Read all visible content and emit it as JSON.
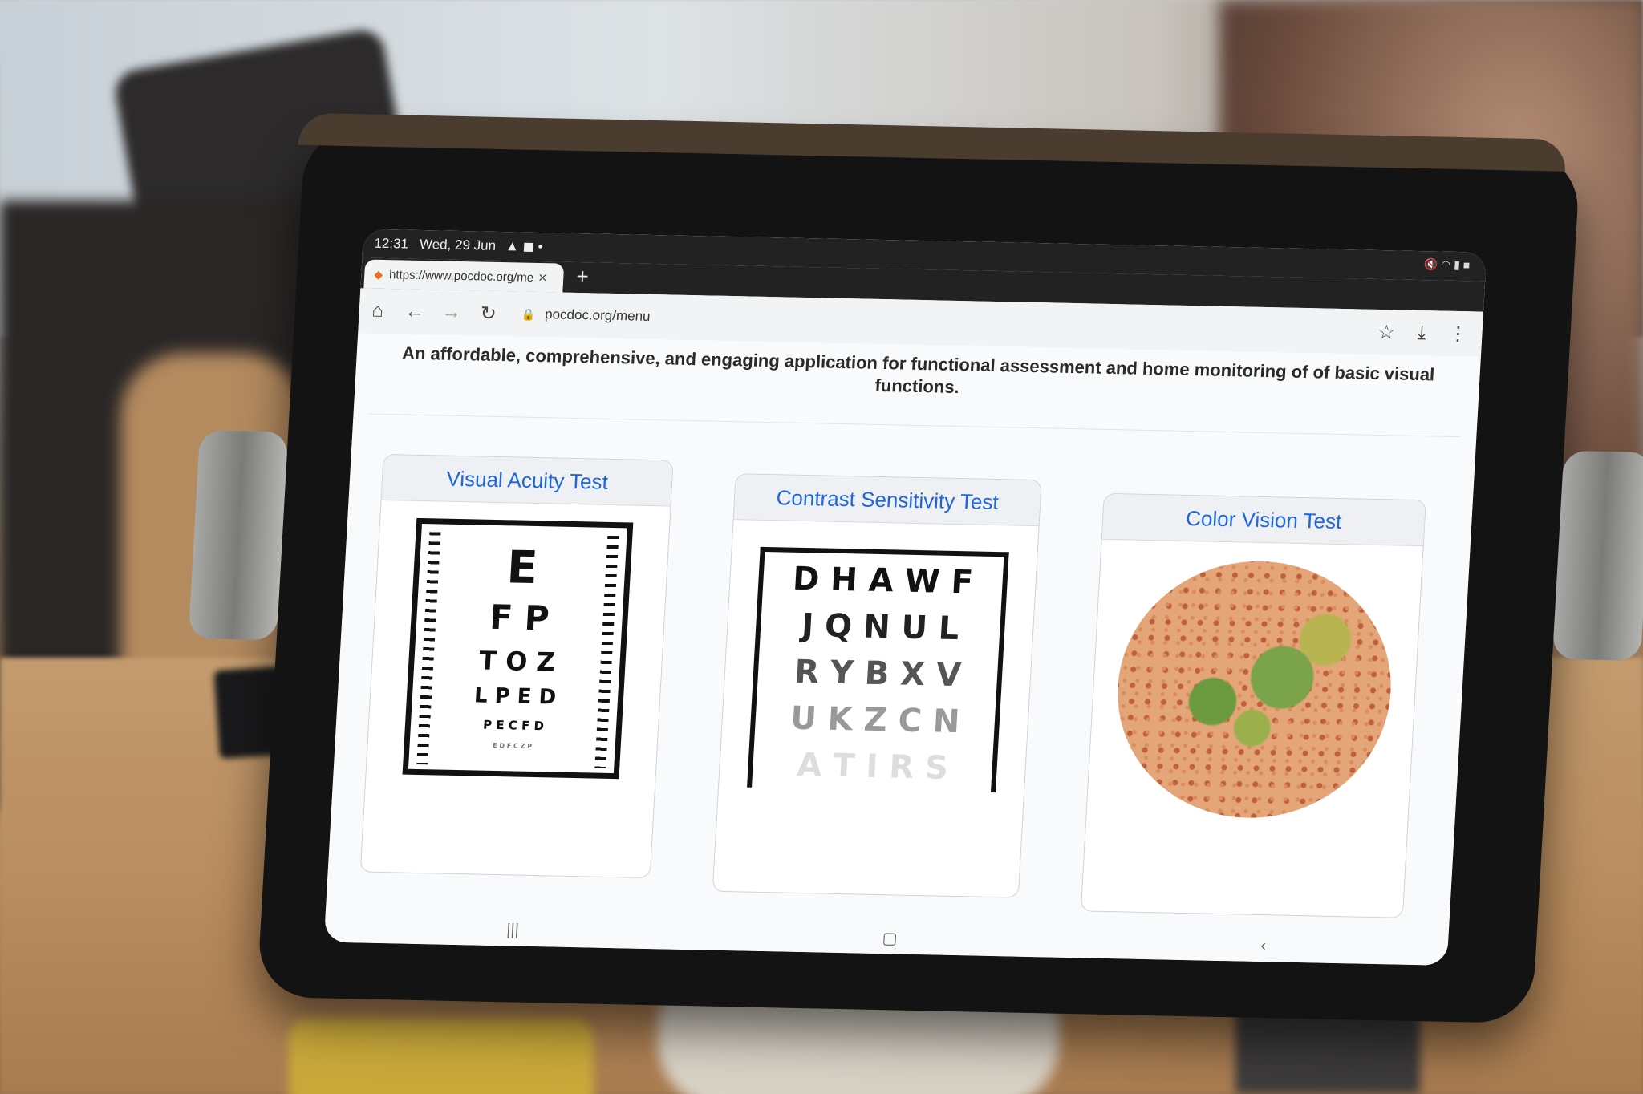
{
  "status_bar": {
    "time": "12:31",
    "date": "Wed, 29 Jun"
  },
  "browser": {
    "tab_title": "https://www.pocdoc.org/me",
    "new_tab_label": "+",
    "close_tab_label": "×",
    "address": "pocdoc.org/menu"
  },
  "page": {
    "intro": "An affordable, comprehensive, and engaging application for functional assessment and home monitoring of of basic visual functions."
  },
  "cards": [
    {
      "title": "Visual Acuity Test",
      "rows": [
        "E",
        "F P",
        "T O Z",
        "L P E D",
        "P E C F D",
        "E D F C Z P"
      ]
    },
    {
      "title": "Contrast Sensitivity Test",
      "rows": [
        "D H A W F",
        "J Q N U L",
        "R Y B X V",
        "U K Z C N",
        "A T I R S"
      ]
    },
    {
      "title": "Color Vision Test"
    }
  ],
  "colors": {
    "card_title": "#1d66db",
    "intro_text": "#2a2a2a"
  }
}
